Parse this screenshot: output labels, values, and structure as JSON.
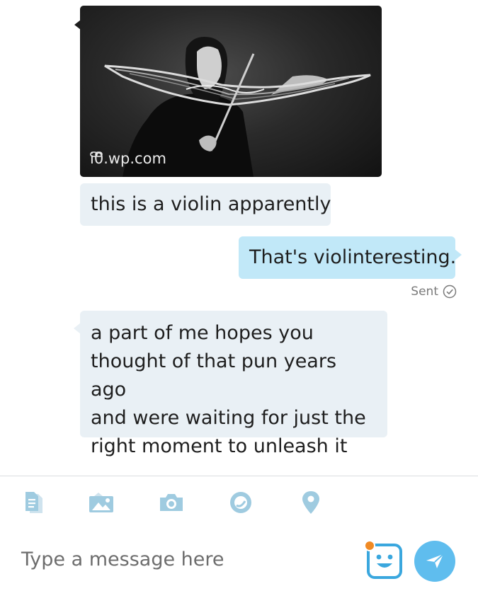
{
  "messages": {
    "image_message": {
      "link_domain": "i0.wp.com",
      "link_icon": "link-icon"
    },
    "incoming_1": {
      "text": "this is a violin apparently"
    },
    "outgoing_1": {
      "text": "That's violinteresting.",
      "status": "Sent",
      "status_icon": "check-circle-icon"
    },
    "incoming_2": {
      "lines": [
        "a part of me hopes you",
        "thought of that pun years ago",
        "and were waiting for just the",
        "right moment to unleash it"
      ]
    }
  },
  "toolbar": {
    "icons": [
      "file-icon",
      "photo-icon",
      "camera-icon",
      "video-message-icon",
      "location-pin-icon"
    ]
  },
  "composer": {
    "placeholder": "Type a message here",
    "emoji_icon": "emoji-icon",
    "send_icon": "send-icon"
  },
  "colors": {
    "incoming_bubble": "#e9f0f5",
    "outgoing_bubble": "#c1e8f8",
    "icon_blue": "#9fcbe0",
    "send_button": "#5fbdee",
    "notification_dot": "#f08a24"
  }
}
